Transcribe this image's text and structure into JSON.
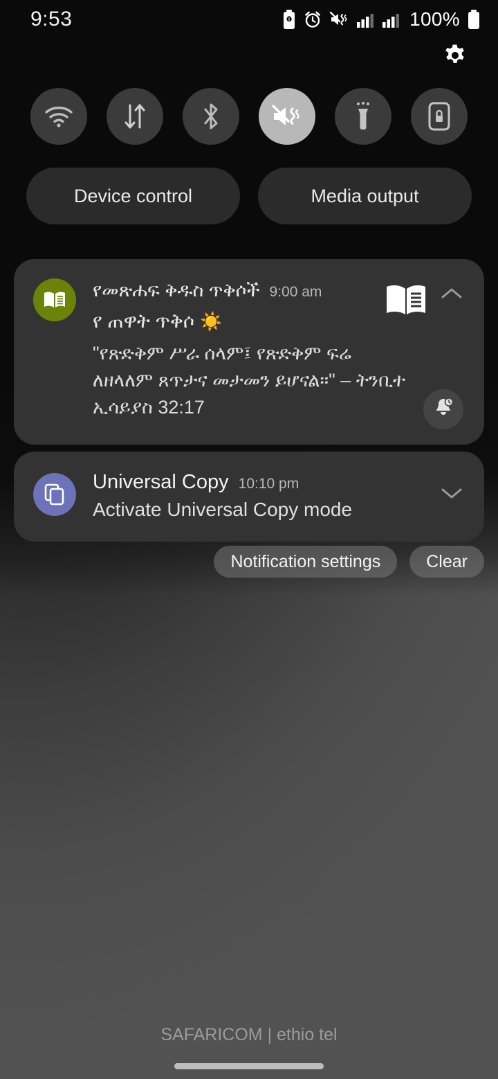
{
  "status_bar": {
    "time": "9:53",
    "battery_percent": "100%",
    "icons": [
      "battery-saver-icon",
      "alarm-icon",
      "mute-vibrate-icon",
      "signal-bars-sim1-icon",
      "signal-bars-sim2-icon",
      "battery-icon"
    ]
  },
  "header": {
    "settings_icon": "gear-icon"
  },
  "quick_settings": {
    "tiles": [
      {
        "name": "wifi",
        "label": "Wi-Fi",
        "icon": "wifi-icon",
        "active": false
      },
      {
        "name": "mobile-data",
        "label": "Mobile data",
        "icon": "data-transfer-icon",
        "active": false
      },
      {
        "name": "bluetooth",
        "label": "Bluetooth",
        "icon": "bluetooth-icon",
        "active": false
      },
      {
        "name": "sound-mode",
        "label": "Mute",
        "icon": "mute-vibrate-icon",
        "active": true
      },
      {
        "name": "flashlight",
        "label": "Flashlight",
        "icon": "flashlight-icon",
        "active": false
      },
      {
        "name": "auto-rotate",
        "label": "Rotation lock",
        "icon": "rotation-lock-icon",
        "active": false
      }
    ],
    "active_tile_color": "#b8b8b8",
    "inactive_tile_color": "#3b3b3b"
  },
  "pills": {
    "device_control": "Device control",
    "media_output": "Media output"
  },
  "notifications": [
    {
      "app_name": "የመጽሐፍ ቅዱስ ጥቅሶች",
      "time": "9:00 am",
      "title": "የ ጠዋት ጥቅሶ",
      "title_emoji": "☀️",
      "text": "\"የጽድቅም ሥራ ሰላም፤ የጽድቅም ፍሬ ለዘላለም ጸጥታና መታመን ይሆናል።\" – ትንቢተ ኢሳይያስ 32:17",
      "icon": "book-icon",
      "icon_color": "#6d8307",
      "picture_icon": "open-book-icon",
      "expand_icon": "chevron-up-icon",
      "snooze_icon": "bell-clock-icon"
    },
    {
      "app_name": "Universal Copy",
      "time": "10:10 pm",
      "title": "Activate Universal Copy mode",
      "icon": "copy-pages-icon",
      "icon_color": "#6c73b8",
      "expand_icon": "chevron-down-icon"
    }
  ],
  "footer_actions": {
    "notification_settings": "Notification settings",
    "clear": "Clear"
  },
  "carrier": "SAFARICOM | ethio tel",
  "nav": {
    "home_bar": "home-gesture-bar"
  }
}
